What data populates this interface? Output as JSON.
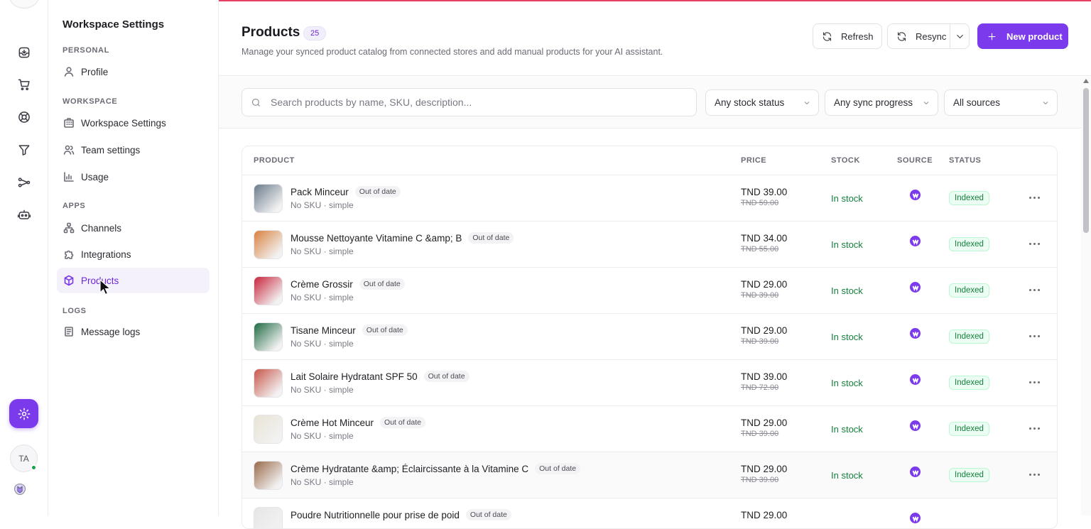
{
  "sidebar": {
    "title": "Workspace Settings",
    "sections": {
      "personal": "PERSONAL",
      "workspace": "WORKSPACE",
      "apps": "APPS",
      "logs": "LOGS"
    },
    "items": {
      "profile": "Profile",
      "workspace_settings": "Workspace Settings",
      "team_settings": "Team settings",
      "usage": "Usage",
      "channels": "Channels",
      "integrations": "Integrations",
      "products": "Products",
      "message_logs": "Message logs"
    },
    "active": "products"
  },
  "rail": {
    "avatar_initials": "TA",
    "icons": [
      "inbox-icon",
      "cart-icon",
      "help-ring-icon",
      "filter-icon",
      "workflow-icon",
      "bot-icon",
      "settings-gear-icon"
    ]
  },
  "header": {
    "title": "Products",
    "count": "25",
    "description": "Manage your synced product catalog from connected stores and add manual products for your AI assistant.",
    "refresh_label": "Refresh",
    "resync_label": "Resync",
    "new_product_label": "New product"
  },
  "filters": {
    "search_placeholder": "Search products by name, SKU, description...",
    "stock_status": "Any stock status",
    "sync_progress": "Any sync progress",
    "sources": "All sources"
  },
  "table": {
    "columns": {
      "product": "PRODUCT",
      "price": "PRICE",
      "stock": "STOCK",
      "source": "SOURCE",
      "status": "STATUS"
    },
    "rows": [
      {
        "name": "Pack Minceur",
        "tag": "Out of date",
        "sub": "No SKU · simple",
        "price": "TND 39.00",
        "old_price": "TND 59.00",
        "stock": "In stock",
        "status": "Indexed",
        "thumb_color": "#6b7b8c"
      },
      {
        "name": "Mousse Nettoyante Vitamine C &amp; B",
        "tag": "Out of date",
        "sub": "No SKU · simple",
        "price": "TND 34.00",
        "old_price": "TND 55.00",
        "stock": "In stock",
        "status": "Indexed",
        "thumb_color": "#d9813e"
      },
      {
        "name": "Crème Grossir",
        "tag": "Out of date",
        "sub": "No SKU · simple",
        "price": "TND 29.00",
        "old_price": "TND 39.00",
        "stock": "In stock",
        "status": "Indexed",
        "thumb_color": "#c8243a"
      },
      {
        "name": "Tisane Minceur",
        "tag": "Out of date",
        "sub": "No SKU · simple",
        "price": "TND 29.00",
        "old_price": "TND 39.00",
        "stock": "In stock",
        "status": "Indexed",
        "thumb_color": "#1f6b43"
      },
      {
        "name": "Lait Solaire Hydratant SPF 50",
        "tag": "Out of date",
        "sub": "No SKU · simple",
        "price": "TND 39.00",
        "old_price": "TND 72.00",
        "stock": "In stock",
        "status": "Indexed",
        "thumb_color": "#c9564a"
      },
      {
        "name": "Crème Hot Minceur",
        "tag": "Out of date",
        "sub": "No SKU · simple",
        "price": "TND 29.00",
        "old_price": "TND 39.00",
        "stock": "In stock",
        "status": "Indexed",
        "thumb_color": "#e8e3d4"
      },
      {
        "name": "Crème Hydratante &amp; Éclaircissante à la Vitamine C",
        "tag": "Out of date",
        "sub": "No SKU · simple",
        "price": "TND 29.00",
        "old_price": "TND 39.00",
        "stock": "In stock",
        "status": "Indexed",
        "thumb_color": "#9a6a4a"
      },
      {
        "name": "Poudre Nutritionnelle pour prise de poid",
        "tag": "Out of date",
        "sub": "",
        "price": "TND 29.00",
        "old_price": "",
        "stock": "",
        "status": "",
        "thumb_color": "#e6e6e6"
      }
    ]
  },
  "colors": {
    "accent": "#7c3aed",
    "in_stock": "#15803d",
    "indexed_bg": "#ecfdf3"
  }
}
